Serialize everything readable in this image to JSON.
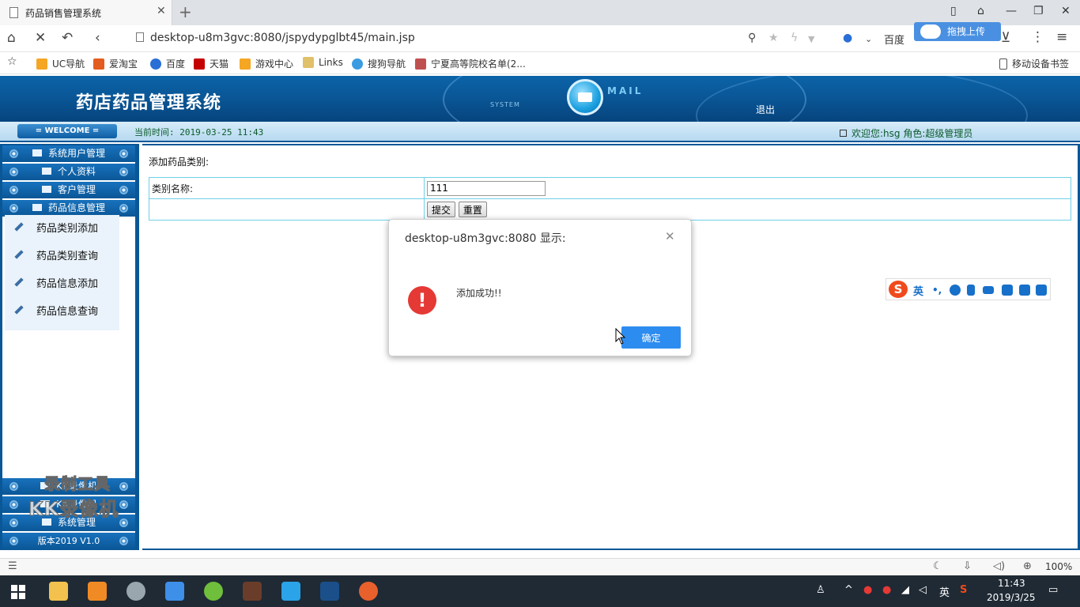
{
  "browser": {
    "tab_title": "药品销售管理系统",
    "url": "desktop-u8m3gvc:8080/jspydypglbt45/main.jsp",
    "search_engine": "百度",
    "upload_label": "拖拽上传",
    "bookmarks": [
      "UC导航",
      "爱淘宝",
      "百度",
      "天猫",
      "游戏中心",
      "Links",
      "搜狗导航",
      "宁夏高等院校名单(2..."
    ],
    "mobile_bookmarks": "移动设备书签",
    "zoom": "100%"
  },
  "app": {
    "title": "药店药品管理系统",
    "mail_label": "MAIL",
    "system_label": "SYSTEM",
    "logout": "退出",
    "welcome": "= WELCOME =",
    "current_time": "当前时间: 2019-03-25 11:43",
    "user_info": "欢迎您:hsg 角色:超级管理员"
  },
  "sidebar": {
    "menus_top": [
      "系统用户管理",
      "个人资料",
      "客户管理",
      "药品信息管理"
    ],
    "sub_items": [
      "药品类别添加",
      "药品类别查询",
      "药品信息添加",
      "药品信息查询"
    ],
    "menus_bottom": [
      "KK录像机",
      "KK录像机",
      "系统管理"
    ],
    "version": "版本2019 V1.0"
  },
  "form": {
    "title": "添加药品类别:",
    "category_label": "类别名称:",
    "category_value": "111",
    "submit": "提交",
    "reset": "重置"
  },
  "dialog": {
    "title": "desktop-u8m3gvc:8080 显示:",
    "message": "添加成功!!",
    "ok": "确定"
  },
  "ime": {
    "lang": "英"
  },
  "watermark": {
    "line1": "录制工具",
    "line2": "KK录像机"
  },
  "taskbar": {
    "time": "11:43",
    "date": "2019/3/25",
    "ime_lang": "英"
  }
}
